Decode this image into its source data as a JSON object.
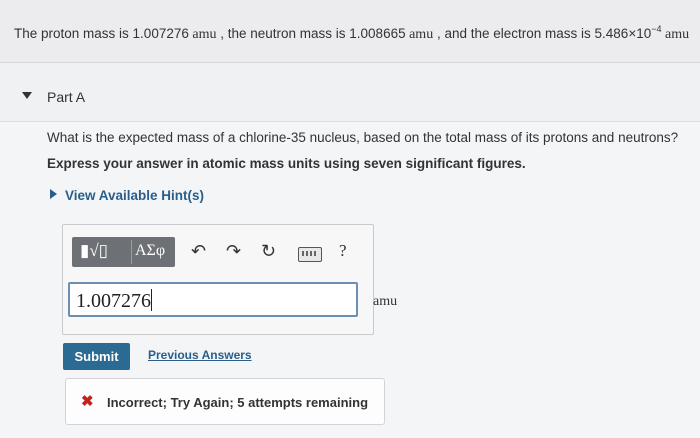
{
  "intro": {
    "before_proton": "The proton mass is ",
    "proton_mass": "1.007276",
    "amu1": " amu",
    "before_neutron": " , the neutron mass is ",
    "neutron_mass": "1.008665",
    "amu2": " amu",
    "before_electron": " , and the electron mass is ",
    "electron_mantissa": "5.486×10",
    "electron_exponent": "−4",
    "amu3": " amu"
  },
  "part": {
    "title": "Part A"
  },
  "question": "What is the expected mass of a chlorine-35 nucleus, based on the total mass of its protons and neutrons?",
  "instruction": "Express your answer in atomic mass units using seven significant figures.",
  "hint_link": "View Available Hint(s)",
  "toolbar": {
    "templates_icon": "templates-icon",
    "symbols_label": "ΑΣφ",
    "undo_icon": "undo-icon",
    "redo_icon": "redo-icon",
    "reset_icon": "reset-icon",
    "keyboard_icon": "keyboard-icon",
    "help_label": "?"
  },
  "answer": {
    "value": "1.007276",
    "unit": "amu"
  },
  "submit_label": "Submit",
  "previous_answers_label": "Previous Answers",
  "feedback": {
    "text": "Incorrect; Try Again; 5 attempts remaining",
    "color": "#c8201d"
  },
  "colors": {
    "accent": "#2a6a93",
    "link": "#2a5e8a",
    "error": "#c8201d"
  }
}
